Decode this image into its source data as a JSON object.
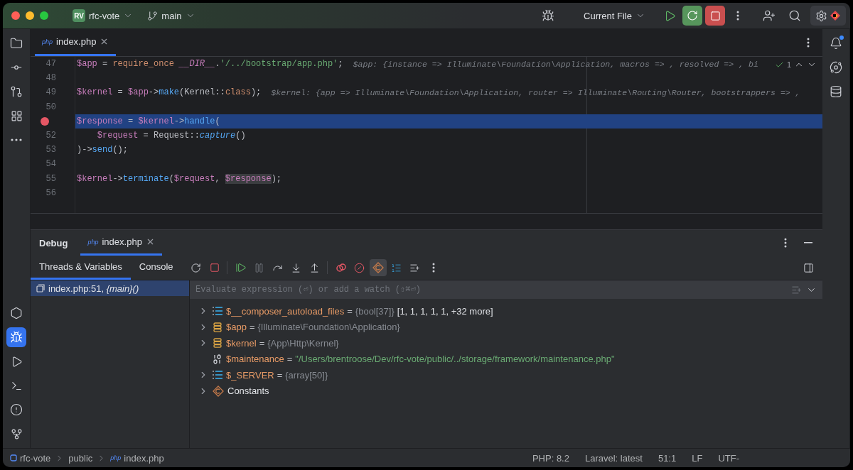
{
  "title_bar": {
    "project_initials": "RV",
    "project": "rfc-vote",
    "branch": "main",
    "run_config": "Current File"
  },
  "editor": {
    "tabs": [
      {
        "lang": "php",
        "label": "index.php",
        "selected": true
      }
    ],
    "inspection_count": "1",
    "lines": [
      {
        "number": "47",
        "breakpoint": false,
        "current": false,
        "tokens": [
          {
            "kind": "var",
            "text": "$app"
          },
          {
            "kind": "plain",
            "text": " = "
          },
          {
            "kind": "kw",
            "text": "require_once "
          },
          {
            "kind": "const",
            "text": "__DIR__"
          },
          {
            "kind": "plain",
            "text": "."
          },
          {
            "kind": "str",
            "text": "'/../bootstrap/app.php'"
          },
          {
            "kind": "plain",
            "text": ";"
          }
        ],
        "hint": "$app: {instance => Illuminate\\Foundation\\Application, macros => , resolved => , bi"
      },
      {
        "number": "48",
        "breakpoint": false,
        "current": false
      },
      {
        "number": "49",
        "breakpoint": false,
        "current": false,
        "tokens": [
          {
            "kind": "var",
            "text": "$kernel"
          },
          {
            "kind": "plain",
            "text": " = "
          },
          {
            "kind": "var",
            "text": "$app"
          },
          {
            "kind": "plain",
            "text": "->"
          },
          {
            "kind": "fn",
            "text": "make"
          },
          {
            "kind": "plain",
            "text": "(Kernel::"
          },
          {
            "kind": "kw",
            "text": "class"
          },
          {
            "kind": "plain",
            "text": ");"
          }
        ],
        "hint": "$kernel: {app => Illuminate\\Foundation\\Application, router => Illuminate\\Routing\\Router, bootstrappers => ,"
      },
      {
        "number": "50",
        "breakpoint": false,
        "current": false
      },
      {
        "breakpoint": true,
        "current": true,
        "tokens": [
          {
            "kind": "var",
            "text": "$response"
          },
          {
            "kind": "plain",
            "text": " = "
          },
          {
            "kind": "var",
            "text": "$kernel"
          },
          {
            "kind": "plain",
            "text": "->"
          },
          {
            "kind": "fn",
            "text": "handle"
          },
          {
            "kind": "plain",
            "text": "("
          }
        ]
      },
      {
        "number": "52",
        "breakpoint": false,
        "current": false,
        "tokens": [
          {
            "kind": "var",
            "text": "    $request"
          },
          {
            "kind": "plain",
            "text": " = Request::"
          },
          {
            "kind": "fn_italic",
            "text": "capture"
          },
          {
            "kind": "plain",
            "text": "()"
          }
        ]
      },
      {
        "number": "53",
        "breakpoint": false,
        "current": false,
        "tokens": [
          {
            "kind": "plain",
            "text": ")->"
          },
          {
            "kind": "fn",
            "text": "send"
          },
          {
            "kind": "plain",
            "text": "();"
          }
        ]
      },
      {
        "number": "54",
        "breakpoint": false,
        "current": false
      },
      {
        "number": "55",
        "breakpoint": false,
        "current": false,
        "tokens": [
          {
            "kind": "var",
            "text": "$kernel"
          },
          {
            "kind": "plain",
            "text": "->"
          },
          {
            "kind": "fn",
            "text": "terminate"
          },
          {
            "kind": "plain",
            "text": "("
          },
          {
            "kind": "var",
            "text": "$request"
          },
          {
            "kind": "plain",
            "text": ", "
          },
          {
            "kind": "var_marked",
            "text": "$response"
          },
          {
            "kind": "plain",
            "text": ");"
          }
        ]
      },
      {
        "number": "56",
        "breakpoint": false,
        "current": false
      }
    ]
  },
  "debug": {
    "title": "Debug",
    "session_tabs": [
      {
        "lang": "php",
        "label": "index.php",
        "selected": true
      }
    ],
    "tabs": [
      {
        "label": "Threads & Variables",
        "selected": true
      },
      {
        "label": "Console",
        "selected": false
      }
    ],
    "frames": [
      {
        "text": "index.php:51, *{main}()*",
        "selected": true
      }
    ],
    "evaluate_placeholder": "Evaluate expression (⏎) or add a watch (⇧⌘⏎)",
    "variables": [
      {
        "kind": "array",
        "expandable": true,
        "name": "$__composer_autoload_files",
        "separator": "=",
        "type": "{bool[37]}",
        "value": "[1, 1, 1, 1, 1, +32 more]",
        "quoted": false
      },
      {
        "kind": "object",
        "expandable": true,
        "name": "$app",
        "separator": "=",
        "type": "{Illuminate\\Foundation\\Application}"
      },
      {
        "kind": "object",
        "expandable": true,
        "name": "$kernel",
        "separator": "=",
        "type": "{App\\Http\\Kernel}"
      },
      {
        "kind": "scalar",
        "expandable": false,
        "name": "$maintenance",
        "separator": "=",
        "value": "\"/Users/brentroose/Dev/rfc-vote/public/../storage/framework/maintenance.php\"",
        "quoted": true
      },
      {
        "kind": "array",
        "expandable": true,
        "name": "$_SERVER",
        "separator": "=",
        "type": "{array[50]}"
      },
      {
        "kind": "constants",
        "expandable": true,
        "name": "Constants"
      }
    ]
  },
  "breadcrumbs": [
    {
      "kind": "module",
      "label": "rfc-vote"
    },
    {
      "kind": "folder",
      "label": "public"
    },
    {
      "kind": "file",
      "lang": "php",
      "label": "index.php"
    }
  ],
  "status": [
    "PHP: 8.2",
    "Laravel: latest",
    "51:1",
    "LF",
    "UTF-"
  ]
}
